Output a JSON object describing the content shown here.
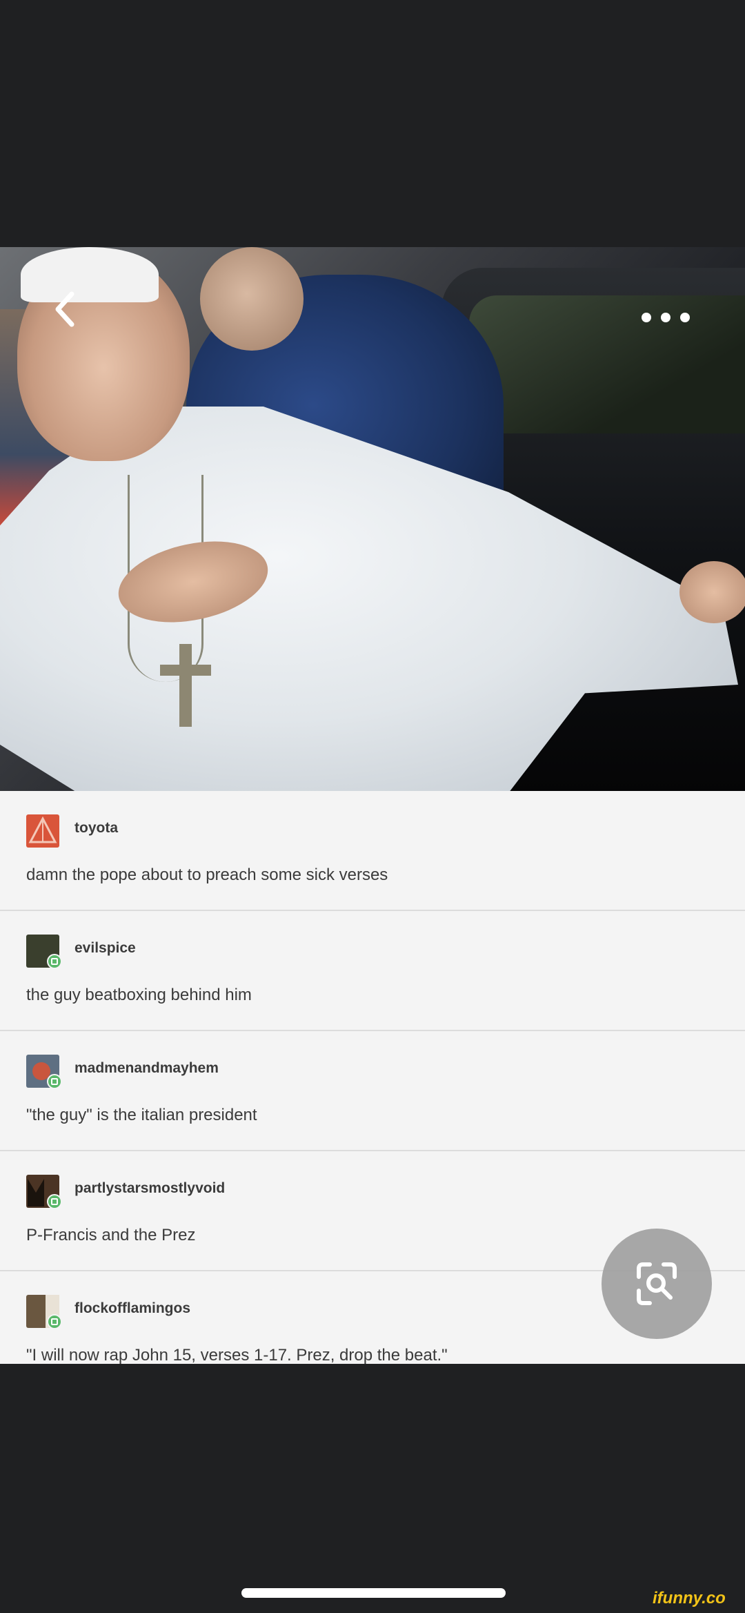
{
  "nav": {
    "back_icon": "chevron-left-icon",
    "more_icon": "more-horizontal-icon"
  },
  "post_image": {
    "description_icon": "photo"
  },
  "notes": [
    {
      "username": "toyota",
      "text": "damn the pope about to preach some sick verses",
      "avatar_color": "#d9553a",
      "reblog": false
    },
    {
      "username": "evilspice",
      "text": "the guy beatboxing behind him",
      "avatar_color": "#3a3f2d",
      "reblog": true
    },
    {
      "username": "madmenandmayhem",
      "text": "\"the guy\" is the italian president",
      "avatar_color": "#5e6f82",
      "reblog": true
    },
    {
      "username": "partlystarsmostlyvoid",
      "text": "P-Francis and the Prez",
      "avatar_color": "#4b3424",
      "reblog": true
    },
    {
      "username": "flockofflamingos",
      "text": "\"I will now rap John 15, verses 1-17. Prez, drop the beat.\"",
      "avatar_color": "#6a5740",
      "reblog": true
    }
  ],
  "lens_button_icon": "visual-search-icon",
  "watermark": "ifunny.co",
  "colors": {
    "background": "#1f2022",
    "card": "#f4f4f4",
    "text": "#3b3b3b",
    "reblog_green": "#5ab86a",
    "watermark": "#f2c318"
  }
}
